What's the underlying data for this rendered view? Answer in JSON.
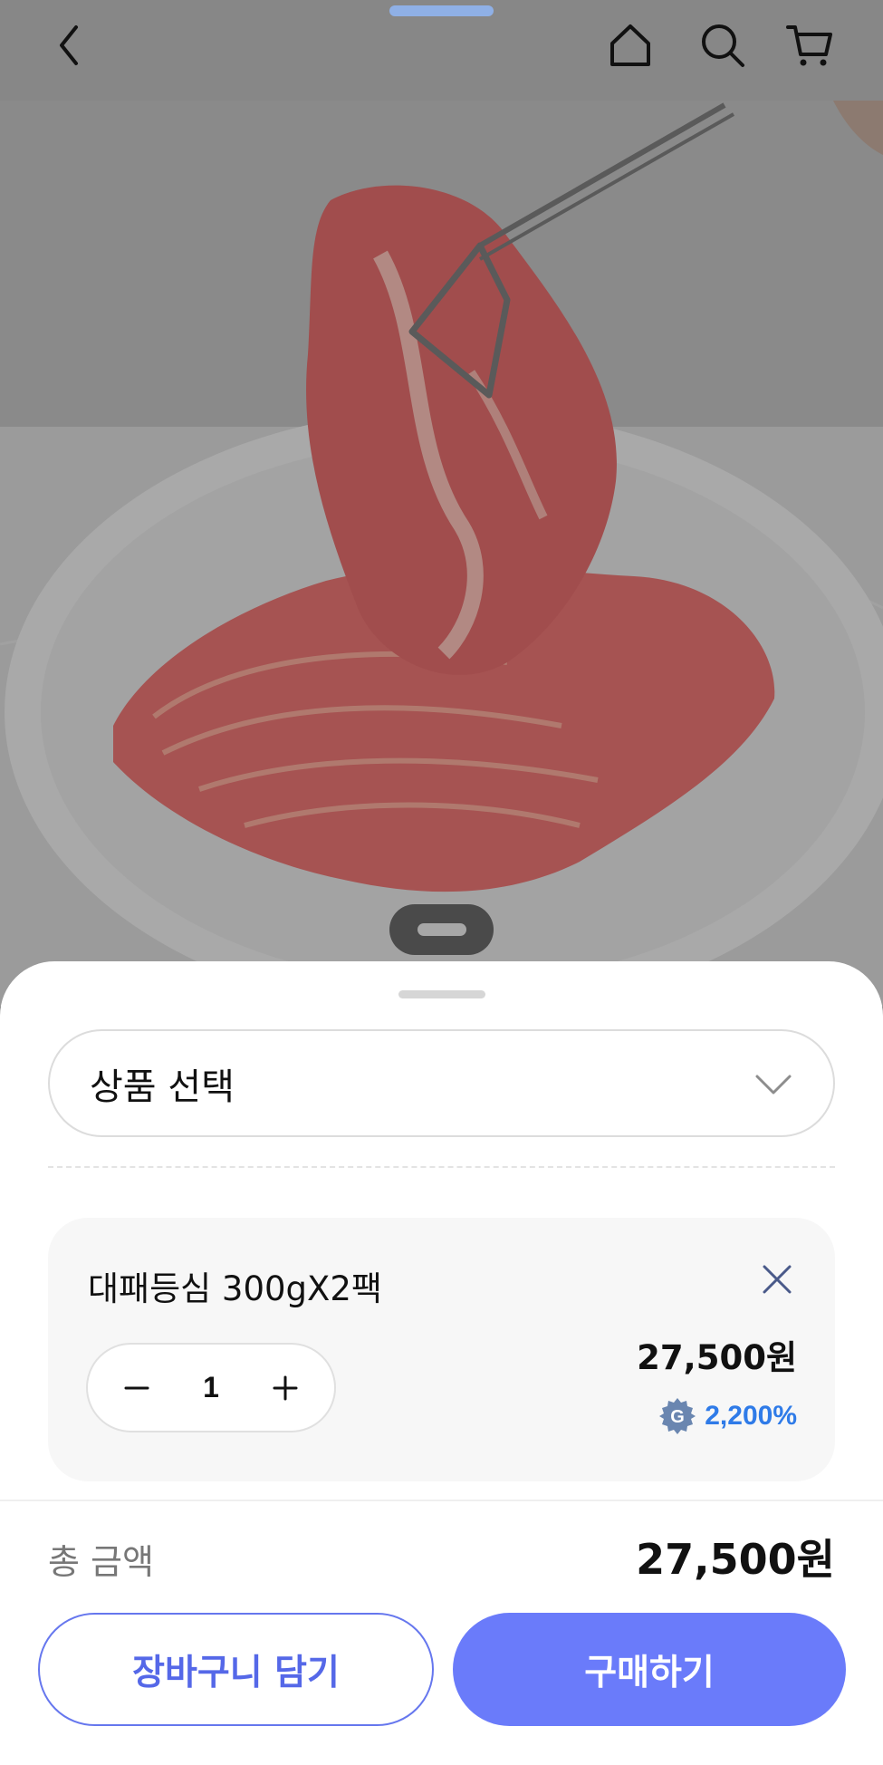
{
  "header": {
    "icons": [
      "back-icon",
      "home-icon",
      "search-icon",
      "cart-icon"
    ]
  },
  "product_image": {
    "subject": "sliced marbled beef brisket on white plate"
  },
  "sheet": {
    "select_label": "상품 선택",
    "option": {
      "name": "대패등심 300gX2팩",
      "quantity": "1",
      "price": "27,500원",
      "point": "2,200%"
    },
    "total_label": "총 금액",
    "total_value": "27,500원",
    "cart_button": "장바구니 담기",
    "buy_button": "구매하기"
  },
  "colors": {
    "accent": "#6a7bfa",
    "point_blue": "#2f7be8",
    "dim_overlay": "#878787"
  }
}
